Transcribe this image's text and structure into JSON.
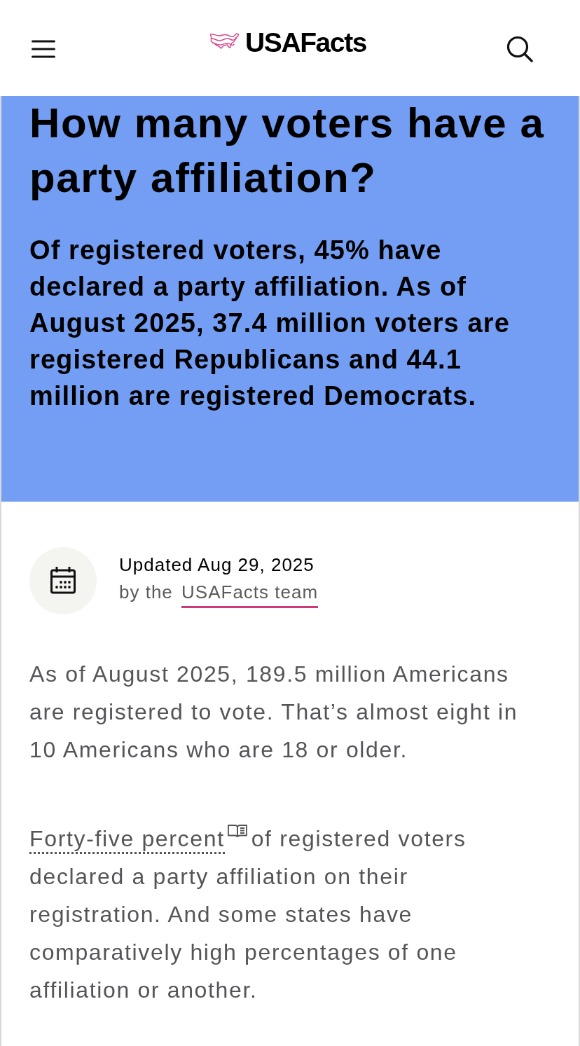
{
  "header": {
    "logo": "USAFacts"
  },
  "hero": {
    "title": "How many voters have a party affiliation?",
    "summary": "Of registered voters, 45% have declared a party affiliation. As of August 2025, 37.4 million voters are registered Republicans and 44.1 million are registered Democrats."
  },
  "meta": {
    "updated": "Updated Aug 29, 2025",
    "byline_prefix": "by the",
    "author_link": "USAFacts team"
  },
  "body": [
    {
      "kind": "plain",
      "text": "As of August 2025, 189.5 million Americans are registered to vote. That’s almost eight in 10 Americans who are 18 or older."
    },
    {
      "kind": "glossary",
      "term": "Forty-five percent",
      "text": "of registered voters declared a party affiliation on their registration. And some states have comparatively high percentages of one affiliation or another."
    }
  ]
}
